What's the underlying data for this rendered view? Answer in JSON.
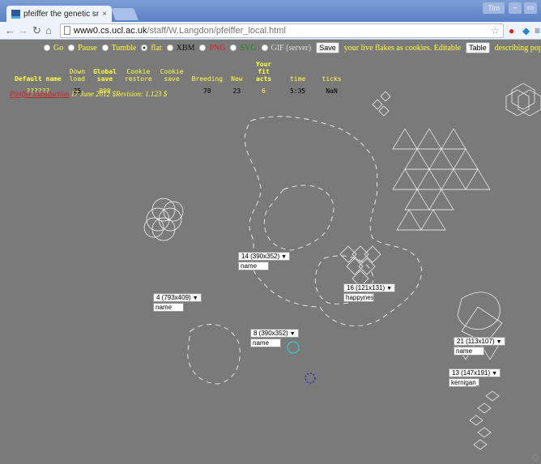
{
  "browser": {
    "tab_title": "pfeiffer the genetic snov",
    "tab_close": "×",
    "user_badge": "Tim",
    "url_host": "www0.cs.ucl.ac.uk",
    "url_path": "/staff/W.Langdon/pfeiffer_local.html",
    "icons": [
      "back-icon",
      "forward-icon",
      "reload-icon",
      "home-icon",
      "star-icon",
      "extension-icon",
      "menu-icon"
    ]
  },
  "controls": {
    "go": "Go",
    "pause": "Pause",
    "tumble": "Tumble",
    "flat": "flat",
    "xbm": "XBM",
    "png": "PNG",
    "svg": "SVG",
    "gif": "GIF (server)",
    "save_button": "Save",
    "save_text": "your live flakes as cookies. Editable",
    "table_button": "Table",
    "table_text": "describing population.",
    "selected": "flat"
  },
  "stats": {
    "headers": [
      "Default name",
      "Down load",
      "Global save",
      "Cookie restore",
      "Cookie save",
      "Breeding",
      "New",
      "Your fit acts",
      "time",
      "ticks"
    ],
    "values": [
      "??????",
      "25",
      "000",
      "",
      "",
      "70",
      "23",
      "6",
      "5:35",
      "NaN"
    ]
  },
  "intro": {
    "link": "Pfeiffer introduction",
    "text": "17 June 2012 $Revision: 1.123 $"
  },
  "populations": [
    {
      "label": "14 (390x352)",
      "name": "name"
    },
    {
      "label": "16 (121x131)",
      "name": "happyness"
    },
    {
      "label": "4 (793x409)",
      "name": "name"
    },
    {
      "label": "8 (390x352)",
      "name": "name"
    },
    {
      "label": "21 (113x107)",
      "name": "name"
    },
    {
      "label": "13 (147x191)",
      "name": "kernigan_w"
    }
  ],
  "colors": {
    "background": "#7a7a7a",
    "accent_text": "#ffff40",
    "link": "#d62020",
    "chrome": "#6b8fcf"
  }
}
